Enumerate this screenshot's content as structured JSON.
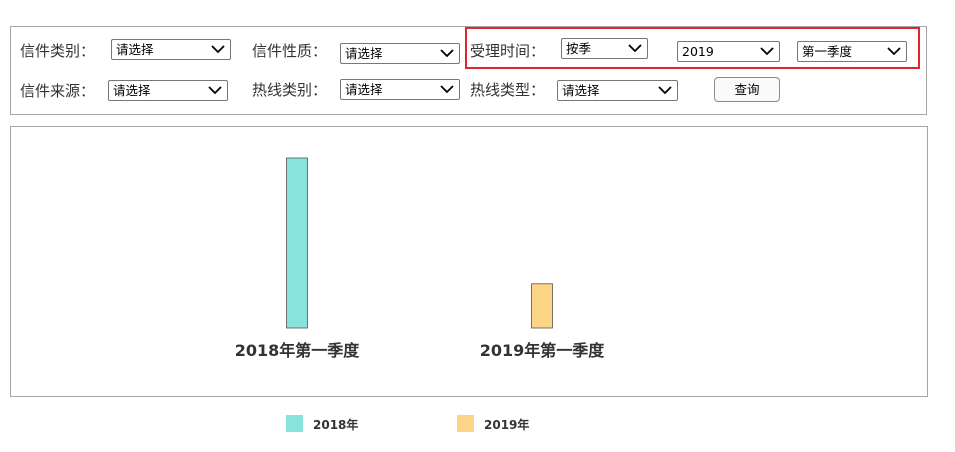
{
  "filters": {
    "letter_category": {
      "label": "信件类别：",
      "value": "请选择"
    },
    "letter_nature": {
      "label": "信件性质：",
      "value": "请选择"
    },
    "accept_time": {
      "label": "受理时间：",
      "mode": "按季",
      "year": "2019",
      "quarter": "第一季度"
    },
    "letter_source": {
      "label": "信件来源：",
      "value": "请选择"
    },
    "hotline_category": {
      "label": "热线类别：",
      "value": "请选择"
    },
    "hotline_type": {
      "label": "热线类型：",
      "value": "请选择"
    },
    "query_button": "查询"
  },
  "icons": {
    "dropdown": "chevron-down-icon"
  },
  "chart_data": {
    "type": "bar",
    "categories": [
      "2018年第一季度",
      "2019年第一季度"
    ],
    "series": [
      {
        "name": "2018年",
        "color": "#88e3dc",
        "values": [
          100,
          null
        ]
      },
      {
        "name": "2019年",
        "color": "#fbd486",
        "values": [
          null,
          26
        ]
      }
    ],
    "legend": [
      "2018年",
      "2019年"
    ],
    "legend_position": "bottom",
    "grid": false,
    "ylim": [
      0,
      100
    ]
  }
}
